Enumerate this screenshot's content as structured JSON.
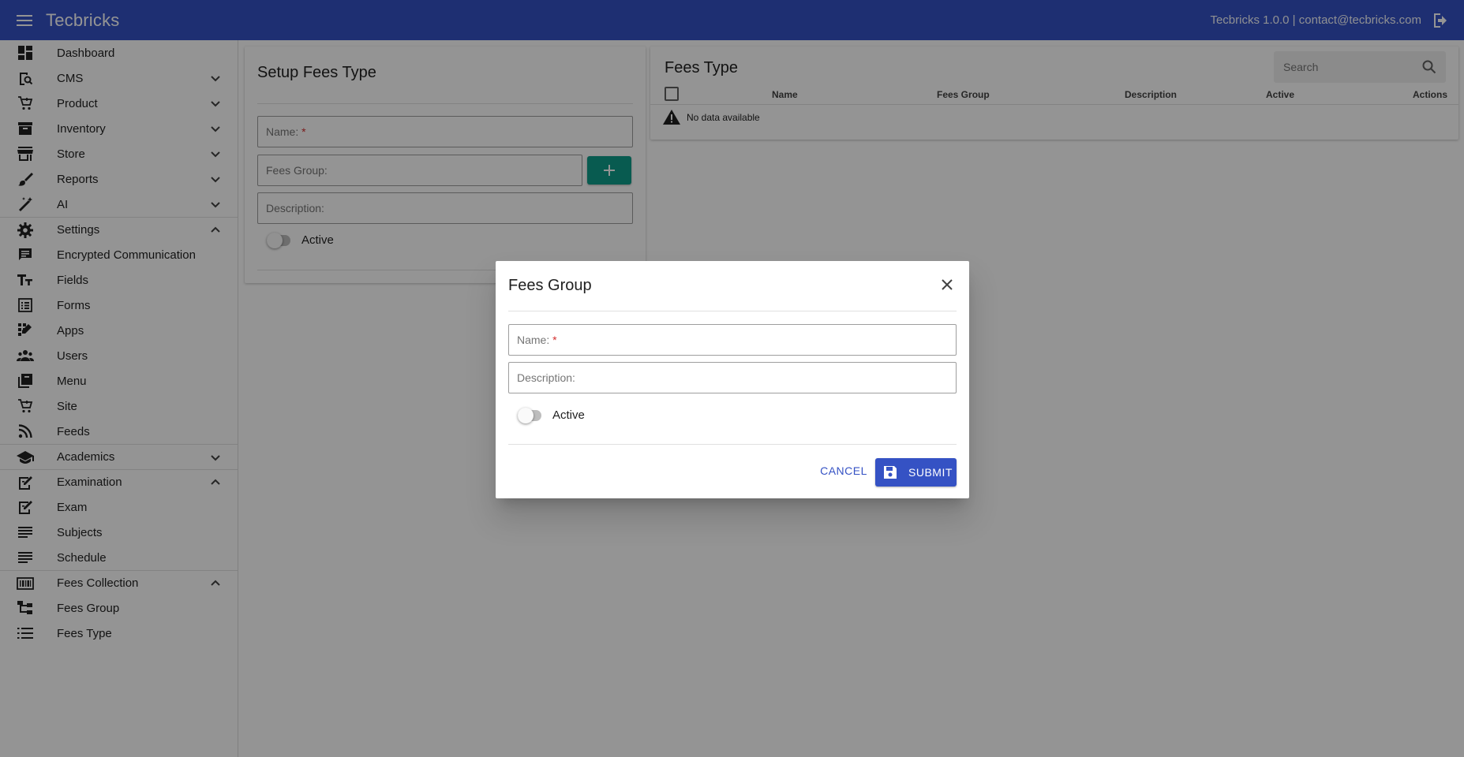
{
  "topbar": {
    "title": "Tecbricks",
    "version_contact": "Tecbricks 1.0.0 | contact@tecbricks.com"
  },
  "sidebar": {
    "items": [
      {
        "label": "Dashboard",
        "icon": "dashboard-icon"
      },
      {
        "label": "CMS",
        "icon": "cms-icon",
        "chevron": "down"
      },
      {
        "label": "Product",
        "icon": "cart-icon",
        "chevron": "down"
      },
      {
        "label": "Inventory",
        "icon": "archive-icon",
        "chevron": "down"
      },
      {
        "label": "Store",
        "icon": "store-icon",
        "chevron": "down"
      },
      {
        "label": "Reports",
        "icon": "brush-icon",
        "chevron": "down"
      },
      {
        "label": "AI",
        "icon": "magic-wand-icon",
        "chevron": "down"
      },
      {
        "label": "Settings",
        "icon": "gear-icon",
        "chevron": "up"
      },
      {
        "label": "Encrypted Communication",
        "icon": "chat-icon"
      },
      {
        "label": "Fields",
        "icon": "text-fields-icon"
      },
      {
        "label": "Forms",
        "icon": "form-list-icon"
      },
      {
        "label": "Apps",
        "icon": "apps-icon"
      },
      {
        "label": "Users",
        "icon": "users-icon"
      },
      {
        "label": "Menu",
        "icon": "library-icon"
      },
      {
        "label": "Site",
        "icon": "cart-icon"
      },
      {
        "label": "Feeds",
        "icon": "rss-icon"
      },
      {
        "label": "Academics",
        "icon": "school-icon",
        "chevron": "down"
      },
      {
        "label": "Examination",
        "icon": "exam-icon",
        "chevron": "up"
      },
      {
        "label": "Exam",
        "icon": "exam-icon"
      },
      {
        "label": "Subjects",
        "icon": "lines-icon"
      },
      {
        "label": "Schedule",
        "icon": "lines-icon"
      },
      {
        "label": "Fees Collection",
        "icon": "barcode-icon",
        "chevron": "up"
      },
      {
        "label": "Fees Group",
        "icon": "tree-icon"
      },
      {
        "label": "Fees Type",
        "icon": "numbered-list-icon"
      }
    ]
  },
  "setup": {
    "title": "Setup Fees Type",
    "name_label": "Name:",
    "required_mark": "*",
    "fees_group_label": "Fees Group:",
    "description_label": "Description:",
    "active_label": "Active"
  },
  "list": {
    "title": "Fees Type",
    "search_placeholder": "Search",
    "columns": {
      "name": "Name",
      "fees_group": "Fees Group",
      "description": "Description",
      "active": "Active",
      "actions": "Actions"
    },
    "no_data": "No data available"
  },
  "dialog": {
    "title": "Fees Group",
    "name_label": "Name:",
    "required_mark": "*",
    "description_label": "Description:",
    "active_label": "Active",
    "cancel": "CANCEL",
    "submit": "SUBMIT"
  },
  "colors": {
    "primary": "#3552c4",
    "teal": "#0e9d8a",
    "required": "#d32f2f"
  }
}
